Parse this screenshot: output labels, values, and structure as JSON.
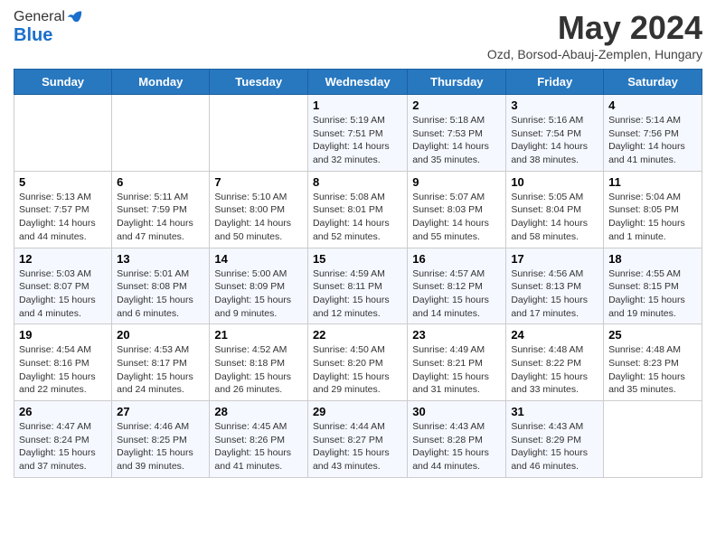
{
  "header": {
    "logo_general": "General",
    "logo_blue": "Blue",
    "month_title": "May 2024",
    "subtitle": "Ozd, Borsod-Abauj-Zemplen, Hungary"
  },
  "days_of_week": [
    "Sunday",
    "Monday",
    "Tuesday",
    "Wednesday",
    "Thursday",
    "Friday",
    "Saturday"
  ],
  "weeks": [
    [
      {
        "day": "",
        "sunrise": "",
        "sunset": "",
        "daylight": ""
      },
      {
        "day": "",
        "sunrise": "",
        "sunset": "",
        "daylight": ""
      },
      {
        "day": "",
        "sunrise": "",
        "sunset": "",
        "daylight": ""
      },
      {
        "day": "1",
        "sunrise": "Sunrise: 5:19 AM",
        "sunset": "Sunset: 7:51 PM",
        "daylight": "Daylight: 14 hours and 32 minutes."
      },
      {
        "day": "2",
        "sunrise": "Sunrise: 5:18 AM",
        "sunset": "Sunset: 7:53 PM",
        "daylight": "Daylight: 14 hours and 35 minutes."
      },
      {
        "day": "3",
        "sunrise": "Sunrise: 5:16 AM",
        "sunset": "Sunset: 7:54 PM",
        "daylight": "Daylight: 14 hours and 38 minutes."
      },
      {
        "day": "4",
        "sunrise": "Sunrise: 5:14 AM",
        "sunset": "Sunset: 7:56 PM",
        "daylight": "Daylight: 14 hours and 41 minutes."
      }
    ],
    [
      {
        "day": "5",
        "sunrise": "Sunrise: 5:13 AM",
        "sunset": "Sunset: 7:57 PM",
        "daylight": "Daylight: 14 hours and 44 minutes."
      },
      {
        "day": "6",
        "sunrise": "Sunrise: 5:11 AM",
        "sunset": "Sunset: 7:59 PM",
        "daylight": "Daylight: 14 hours and 47 minutes."
      },
      {
        "day": "7",
        "sunrise": "Sunrise: 5:10 AM",
        "sunset": "Sunset: 8:00 PM",
        "daylight": "Daylight: 14 hours and 50 minutes."
      },
      {
        "day": "8",
        "sunrise": "Sunrise: 5:08 AM",
        "sunset": "Sunset: 8:01 PM",
        "daylight": "Daylight: 14 hours and 52 minutes."
      },
      {
        "day": "9",
        "sunrise": "Sunrise: 5:07 AM",
        "sunset": "Sunset: 8:03 PM",
        "daylight": "Daylight: 14 hours and 55 minutes."
      },
      {
        "day": "10",
        "sunrise": "Sunrise: 5:05 AM",
        "sunset": "Sunset: 8:04 PM",
        "daylight": "Daylight: 14 hours and 58 minutes."
      },
      {
        "day": "11",
        "sunrise": "Sunrise: 5:04 AM",
        "sunset": "Sunset: 8:05 PM",
        "daylight": "Daylight: 15 hours and 1 minute."
      }
    ],
    [
      {
        "day": "12",
        "sunrise": "Sunrise: 5:03 AM",
        "sunset": "Sunset: 8:07 PM",
        "daylight": "Daylight: 15 hours and 4 minutes."
      },
      {
        "day": "13",
        "sunrise": "Sunrise: 5:01 AM",
        "sunset": "Sunset: 8:08 PM",
        "daylight": "Daylight: 15 hours and 6 minutes."
      },
      {
        "day": "14",
        "sunrise": "Sunrise: 5:00 AM",
        "sunset": "Sunset: 8:09 PM",
        "daylight": "Daylight: 15 hours and 9 minutes."
      },
      {
        "day": "15",
        "sunrise": "Sunrise: 4:59 AM",
        "sunset": "Sunset: 8:11 PM",
        "daylight": "Daylight: 15 hours and 12 minutes."
      },
      {
        "day": "16",
        "sunrise": "Sunrise: 4:57 AM",
        "sunset": "Sunset: 8:12 PM",
        "daylight": "Daylight: 15 hours and 14 minutes."
      },
      {
        "day": "17",
        "sunrise": "Sunrise: 4:56 AM",
        "sunset": "Sunset: 8:13 PM",
        "daylight": "Daylight: 15 hours and 17 minutes."
      },
      {
        "day": "18",
        "sunrise": "Sunrise: 4:55 AM",
        "sunset": "Sunset: 8:15 PM",
        "daylight": "Daylight: 15 hours and 19 minutes."
      }
    ],
    [
      {
        "day": "19",
        "sunrise": "Sunrise: 4:54 AM",
        "sunset": "Sunset: 8:16 PM",
        "daylight": "Daylight: 15 hours and 22 minutes."
      },
      {
        "day": "20",
        "sunrise": "Sunrise: 4:53 AM",
        "sunset": "Sunset: 8:17 PM",
        "daylight": "Daylight: 15 hours and 24 minutes."
      },
      {
        "day": "21",
        "sunrise": "Sunrise: 4:52 AM",
        "sunset": "Sunset: 8:18 PM",
        "daylight": "Daylight: 15 hours and 26 minutes."
      },
      {
        "day": "22",
        "sunrise": "Sunrise: 4:50 AM",
        "sunset": "Sunset: 8:20 PM",
        "daylight": "Daylight: 15 hours and 29 minutes."
      },
      {
        "day": "23",
        "sunrise": "Sunrise: 4:49 AM",
        "sunset": "Sunset: 8:21 PM",
        "daylight": "Daylight: 15 hours and 31 minutes."
      },
      {
        "day": "24",
        "sunrise": "Sunrise: 4:48 AM",
        "sunset": "Sunset: 8:22 PM",
        "daylight": "Daylight: 15 hours and 33 minutes."
      },
      {
        "day": "25",
        "sunrise": "Sunrise: 4:48 AM",
        "sunset": "Sunset: 8:23 PM",
        "daylight": "Daylight: 15 hours and 35 minutes."
      }
    ],
    [
      {
        "day": "26",
        "sunrise": "Sunrise: 4:47 AM",
        "sunset": "Sunset: 8:24 PM",
        "daylight": "Daylight: 15 hours and 37 minutes."
      },
      {
        "day": "27",
        "sunrise": "Sunrise: 4:46 AM",
        "sunset": "Sunset: 8:25 PM",
        "daylight": "Daylight: 15 hours and 39 minutes."
      },
      {
        "day": "28",
        "sunrise": "Sunrise: 4:45 AM",
        "sunset": "Sunset: 8:26 PM",
        "daylight": "Daylight: 15 hours and 41 minutes."
      },
      {
        "day": "29",
        "sunrise": "Sunrise: 4:44 AM",
        "sunset": "Sunset: 8:27 PM",
        "daylight": "Daylight: 15 hours and 43 minutes."
      },
      {
        "day": "30",
        "sunrise": "Sunrise: 4:43 AM",
        "sunset": "Sunset: 8:28 PM",
        "daylight": "Daylight: 15 hours and 44 minutes."
      },
      {
        "day": "31",
        "sunrise": "Sunrise: 4:43 AM",
        "sunset": "Sunset: 8:29 PM",
        "daylight": "Daylight: 15 hours and 46 minutes."
      },
      {
        "day": "",
        "sunrise": "",
        "sunset": "",
        "daylight": ""
      }
    ]
  ]
}
